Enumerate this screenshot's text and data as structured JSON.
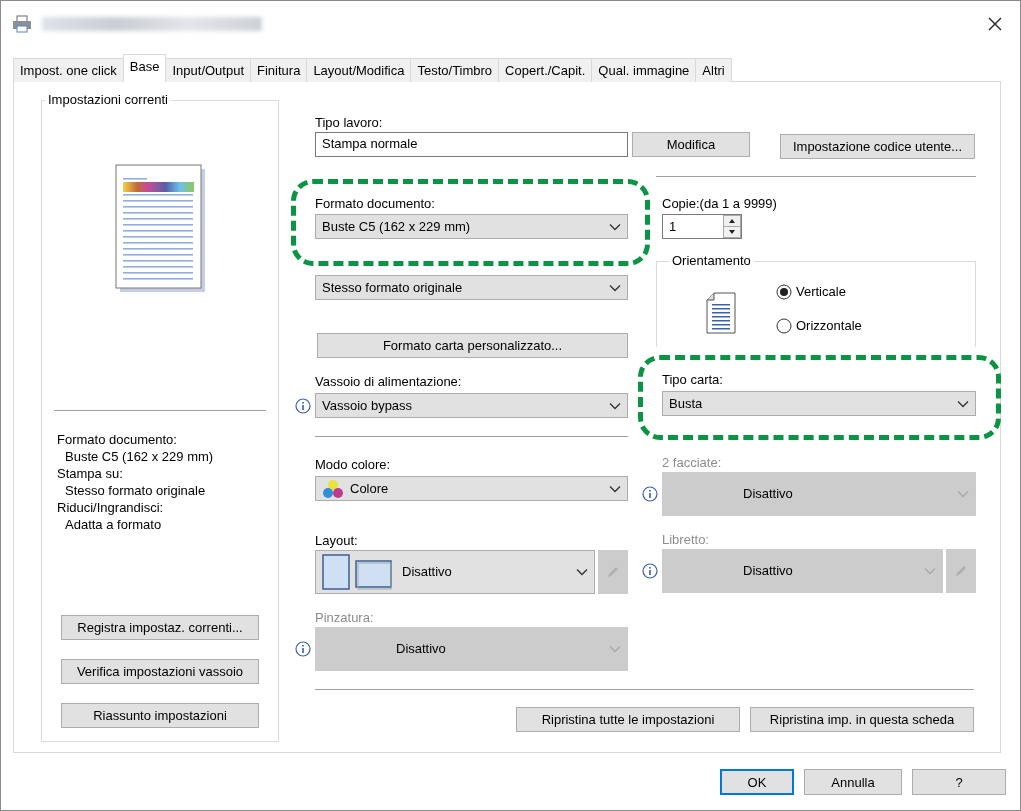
{
  "tabs": [
    {
      "label": "Impost. one click",
      "selected": false
    },
    {
      "label": "Base",
      "selected": true
    },
    {
      "label": "Input/Output",
      "selected": false
    },
    {
      "label": "Finitura",
      "selected": false
    },
    {
      "label": "Layout/Modifica",
      "selected": false
    },
    {
      "label": "Testo/Timbro",
      "selected": false
    },
    {
      "label": "Copert./Capit.",
      "selected": false
    },
    {
      "label": "Qual. immagine",
      "selected": false
    },
    {
      "label": "Altri",
      "selected": false
    }
  ],
  "current_settings": {
    "title": "Impostazioni correnti",
    "summary": [
      {
        "label": "Formato documento:",
        "value": "Buste C5 (162 x 229 mm)"
      },
      {
        "label": "Stampa su:",
        "value": "Stesso formato originale"
      },
      {
        "label": "Riduci/Ingrandisci:",
        "value": "Adatta a formato"
      }
    ],
    "buttons": [
      "Registra impostaz. correnti...",
      "Verifica impostazioni vassoio",
      "Riassunto impostazioni"
    ]
  },
  "job_type": {
    "label": "Tipo lavoro:",
    "value": "Stampa normale",
    "buttons": [
      "Modifica",
      "Impostazione codice utente..."
    ]
  },
  "document_size": {
    "label": "Formato documento:",
    "value": "Buste C5 (162 x 229 mm)",
    "highlighted": true
  },
  "print_on": {
    "value": "Stesso formato originale"
  },
  "custom_size_button": "Formato carta personalizzato...",
  "input_tray": {
    "label": "Vassoio di alimentazione:",
    "value": "Vassoio bypass",
    "info": true
  },
  "color_mode": {
    "label": "Modo colore:",
    "value": "Colore",
    "kind": "color"
  },
  "layout": {
    "label": "Layout:",
    "value": "Disattivo",
    "kind": "layout",
    "edit": {
      "disabled": true
    }
  },
  "stapling": {
    "label": "Pinzatura:",
    "value": "Disattivo",
    "disabled": true,
    "info": true
  },
  "copies": {
    "label": "Copie:(da 1 a 9999)",
    "value": "1"
  },
  "orientation": {
    "label": "Orientamento",
    "options": [
      {
        "label": "Verticale",
        "selected": true
      },
      {
        "label": "Orizzontale",
        "selected": false
      }
    ]
  },
  "paper_type": {
    "label": "Tipo carta:",
    "value": "Busta",
    "highlighted": true
  },
  "duplex": {
    "label": "2 facciate:",
    "value": "Disattivo",
    "disabled": true,
    "info": true
  },
  "booklet": {
    "label": "Libretto:",
    "value": "Disattivo",
    "disabled": true,
    "info": true,
    "edit": {
      "disabled": true
    }
  },
  "reset_buttons": [
    "Ripristina tutte le impostazioni",
    "Ripristina imp. in questa scheda"
  ],
  "footer_buttons": [
    {
      "label": "OK",
      "default": true
    },
    {
      "label": "Annulla",
      "default": false
    },
    {
      "label": "?",
      "default": false
    }
  ]
}
